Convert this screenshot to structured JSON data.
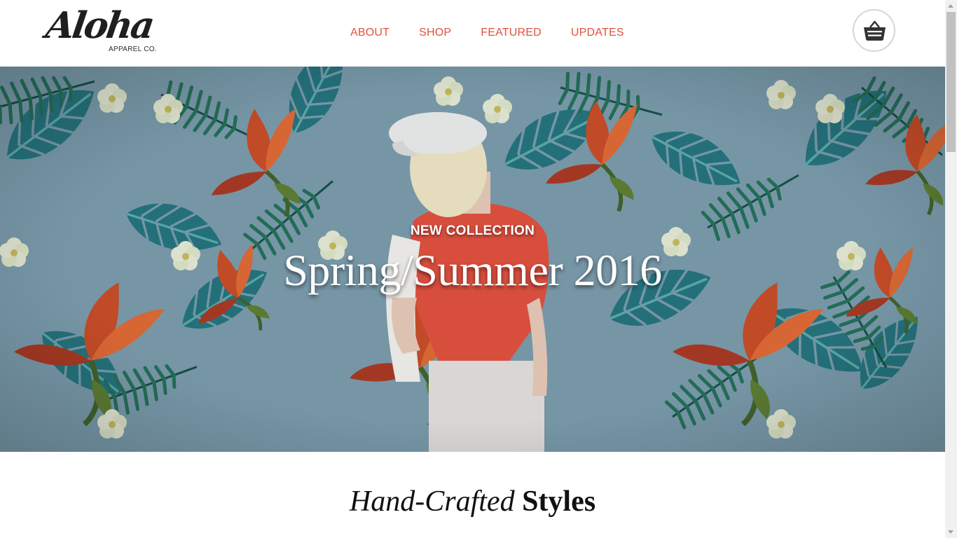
{
  "brand": {
    "logo_script": "Aloha",
    "logo_sub": "APPAREL CO."
  },
  "nav": {
    "items": [
      {
        "label": "ABOUT"
      },
      {
        "label": "SHOP"
      },
      {
        "label": "FEATURED"
      },
      {
        "label": "UPDATES"
      }
    ],
    "cart_icon": "basket-icon"
  },
  "hero": {
    "eyebrow": "NEW COLLECTION",
    "title": "Spring/Summer 2016"
  },
  "section": {
    "title_italic": "Hand-Crafted",
    "title_bold": "Styles"
  },
  "colors": {
    "accent": "#e0523c",
    "hero_bg": "#7898a8",
    "text_dark": "#111111"
  }
}
